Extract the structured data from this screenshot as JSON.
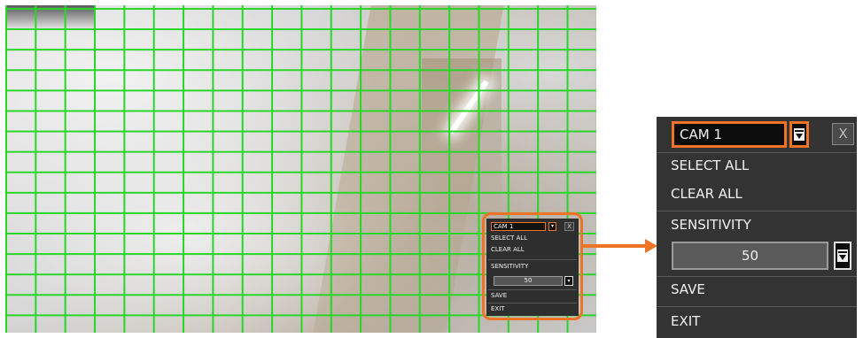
{
  "menu": {
    "camera_value": "CAM 1",
    "close_label": "X",
    "select_all": "SELECT ALL",
    "clear_all": "CLEAR ALL",
    "sensitivity_label": "SENSITIVITY",
    "sensitivity_value": "50",
    "save": "SAVE",
    "exit": "EXIT"
  },
  "icons": {
    "dropdown": "dropdown-arrow-icon",
    "close": "close-icon"
  },
  "colors": {
    "highlight": "#ee7325",
    "grid": "#27d627",
    "menu_background": "#333333"
  }
}
